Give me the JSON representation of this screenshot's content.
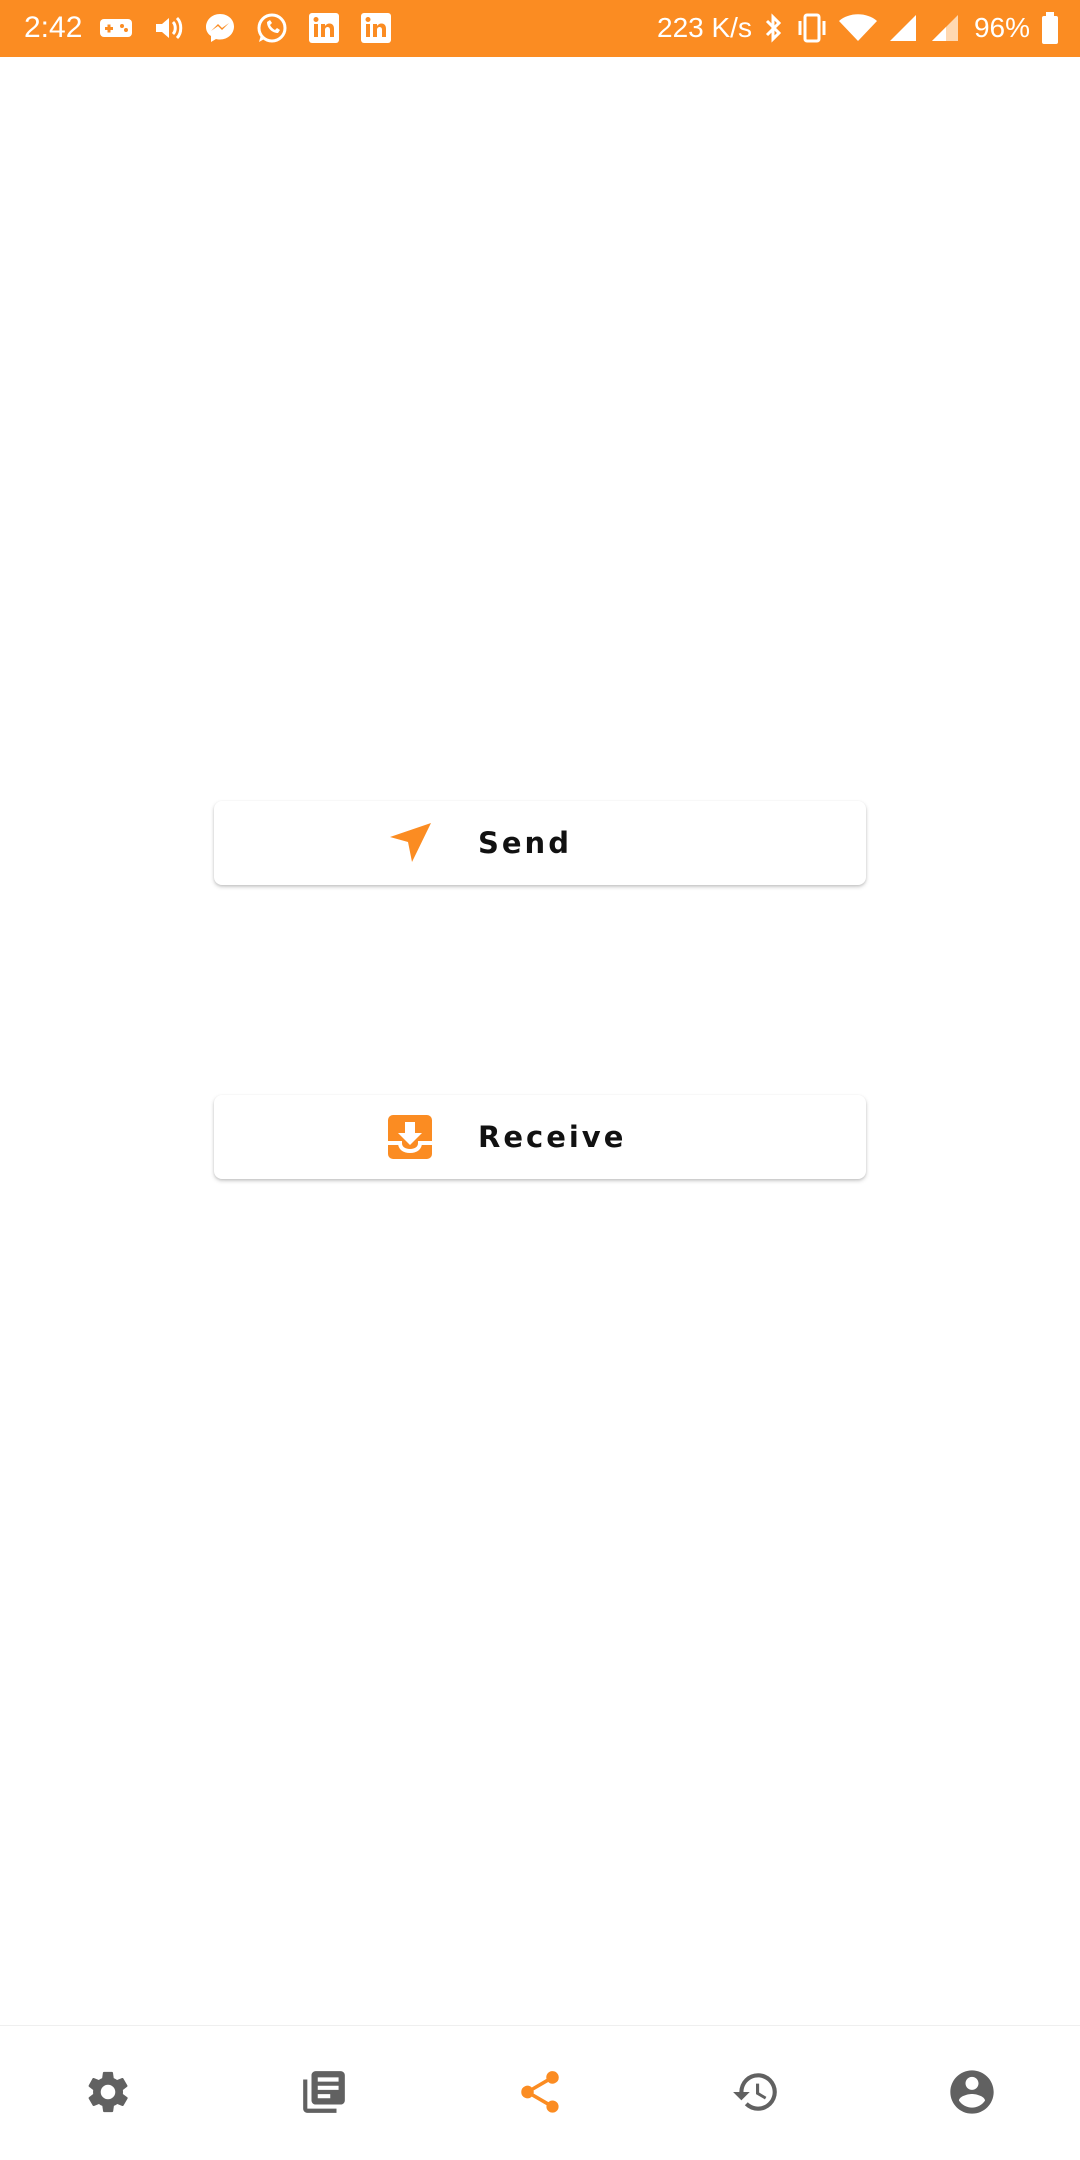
{
  "status_bar": {
    "time": "2:42",
    "network_speed": "223 K/s",
    "battery": "96%",
    "left_icons": [
      "gamepad-icon",
      "volume-icon",
      "messenger-icon",
      "whatsapp-icon",
      "linkedin-icon",
      "linkedin-icon"
    ],
    "right_icons": [
      "bluetooth-icon",
      "vibrate-icon",
      "wifi-icon",
      "signal-icon",
      "signal-roaming-icon",
      "battery-icon"
    ]
  },
  "actions": {
    "send_label": "Send",
    "receive_label": "Receive",
    "send_icon": "send-arrow-icon",
    "receive_icon": "inbox-download-icon"
  },
  "bottom_nav": {
    "items": [
      {
        "icon": "settings-icon",
        "active": false
      },
      {
        "icon": "list-icon",
        "active": false
      },
      {
        "icon": "share-icon",
        "active": true
      },
      {
        "icon": "history-icon",
        "active": false
      },
      {
        "icon": "account-icon",
        "active": false
      }
    ]
  },
  "colors": {
    "accent": "#fb8c22",
    "icon_inactive": "#616161",
    "background": "#ffffff"
  }
}
